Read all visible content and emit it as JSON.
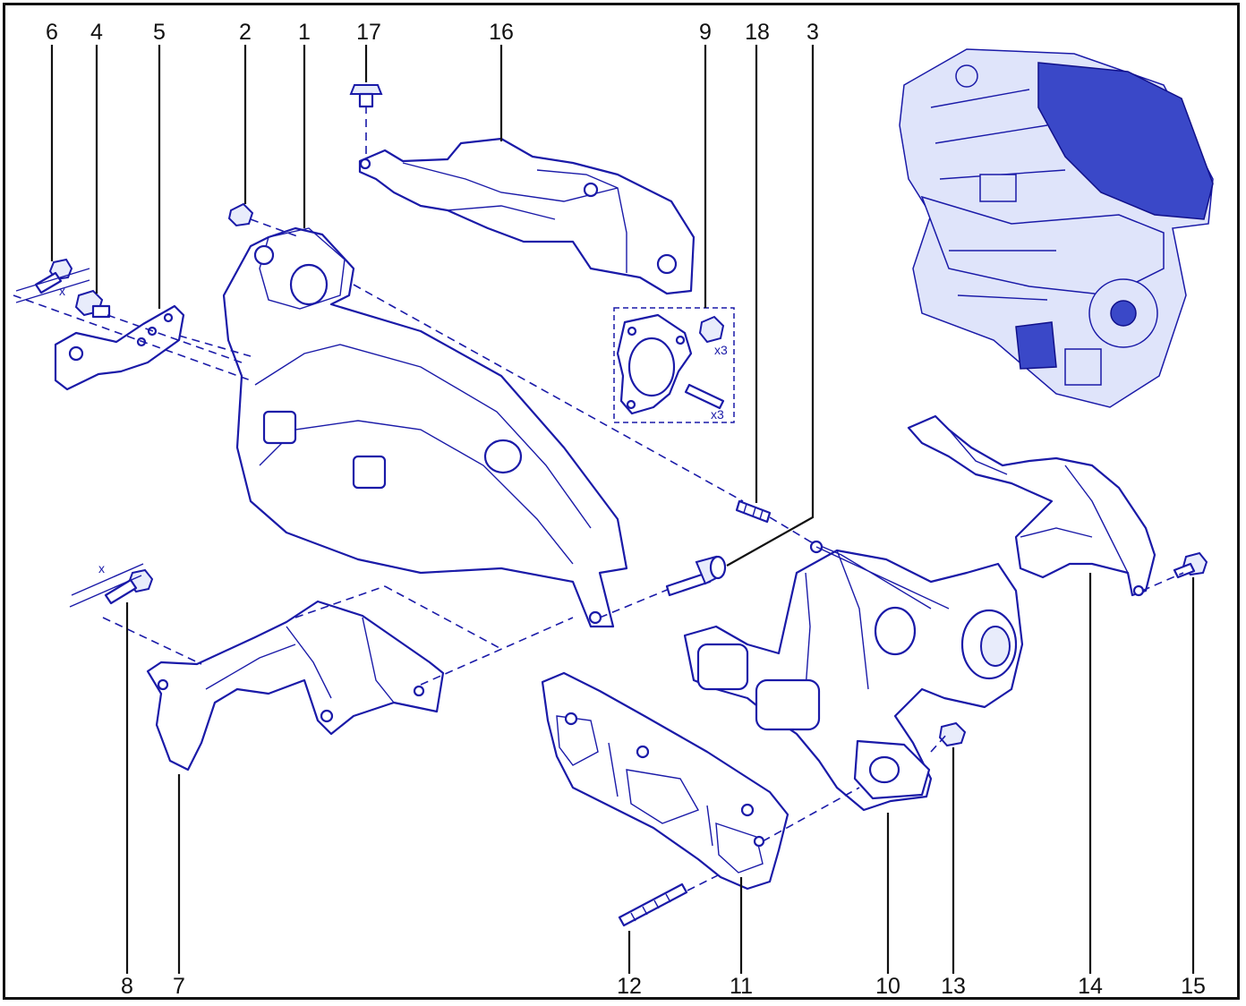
{
  "callouts": {
    "n1": "1",
    "n2": "2",
    "n3": "3",
    "n4": "4",
    "n5": "5",
    "n6": "6",
    "n7": "7",
    "n8": "8",
    "n9": "9",
    "n10": "10",
    "n11": "11",
    "n12": "12",
    "n13": "13",
    "n14": "14",
    "n15": "15",
    "n16": "16",
    "n17": "17",
    "n18": "18"
  },
  "annotations": {
    "x_top": "x",
    "x_bottom": "x",
    "qty_nut": "x3",
    "qty_stud": "x3"
  },
  "colors": {
    "line": "#1a1aa8",
    "text": "#111111"
  }
}
